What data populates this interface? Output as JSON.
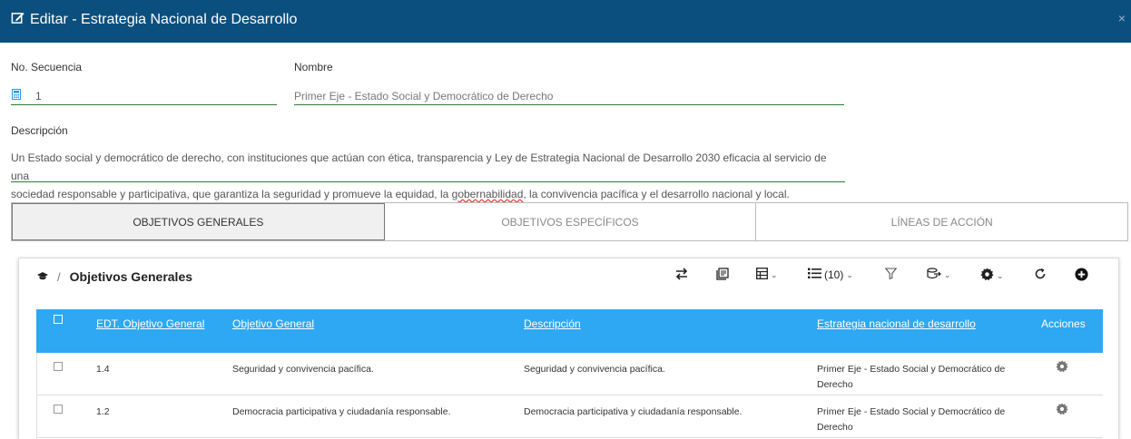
{
  "header": {
    "title": "Editar - Estrategia Nacional de Desarrollo",
    "close": "×"
  },
  "form": {
    "sequence_label": "No. Secuencia",
    "sequence_value": "1",
    "name_label": "Nombre",
    "name_value": "Primer Eje - Estado Social y Democrático de Derecho",
    "description_label": "Descripción",
    "description_line1": "Un Estado social y democrático de derecho, con instituciones que actúan con ética, transparencia y Ley de Estrategia Nacional de Desarrollo 2030 eficacia al servicio de una",
    "description_line2_a": "sociedad responsable y participativa, que garantiza la seguridad y promueve la equidad, la ",
    "description_line2_spell": "gobernabilidad",
    "description_line2_b": ", la convivencia pacífica y el desarrollo nacional y local."
  },
  "tabs": [
    {
      "label": "OBJETIVOS GENERALES"
    },
    {
      "label": "OBJETIVOS ESPECÍFICOS"
    },
    {
      "label": "LÍNEAS DE ACCIÓN"
    }
  ],
  "panel": {
    "separator": "/",
    "title": "Objetivos Generales",
    "page_size": "(10)"
  },
  "grid": {
    "columns": {
      "edt": "EDT. Objetivo General",
      "objective": "Objetivo General",
      "description": "Descripción",
      "strategy": "Estrategia nacional de desarrollo",
      "actions": "Acciones"
    },
    "rows": [
      {
        "edt": "1.4",
        "objective": "Seguridad y convivencia pacífica.",
        "description": "Seguridad y convivencia pacífica.",
        "strategy_line1": "Primer Eje - Estado Social y Democrático de",
        "strategy_line2": "Derecho"
      },
      {
        "edt": "1.2",
        "objective": "Democracia participativa y ciudadanía responsable.",
        "description": "Democracia participativa y ciudadanía responsable.",
        "strategy_line1": "Primer Eje - Estado Social y Democrático de",
        "strategy_line2": "Derecho"
      }
    ]
  },
  "colors": {
    "header": "#0b4f7e",
    "grid_header": "#2ea8f2",
    "underline": "#2e7d32",
    "calc_icon": "#2196f3"
  }
}
